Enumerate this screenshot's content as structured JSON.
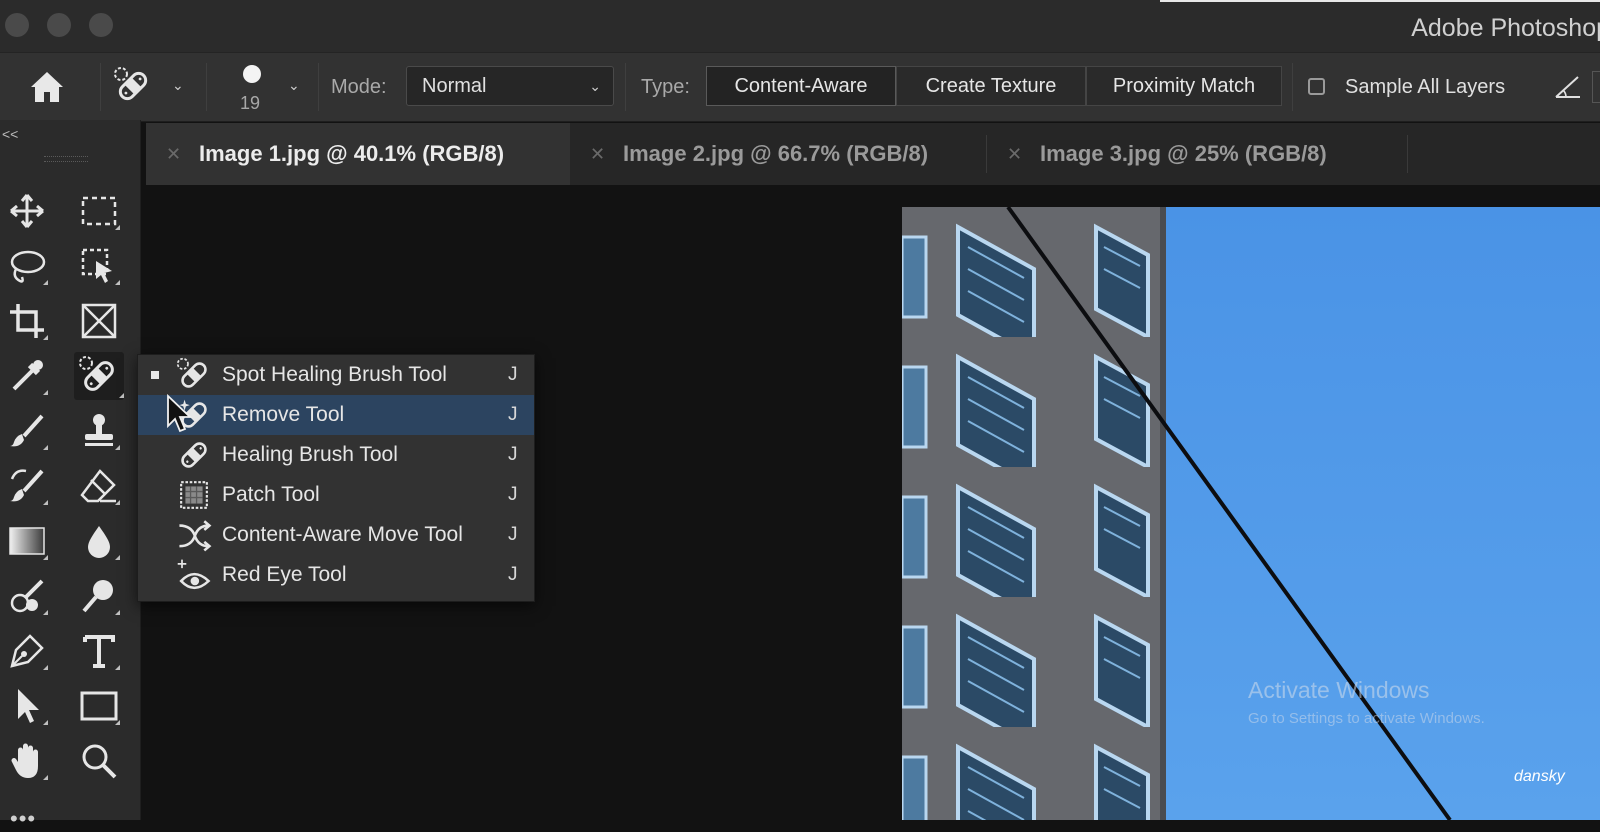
{
  "window": {
    "title": "Adobe Photoshop"
  },
  "options_bar": {
    "brush_size": "19",
    "mode_label": "Mode:",
    "mode_value": "Normal",
    "type_label": "Type:",
    "type_options": [
      "Content-Aware",
      "Create Texture",
      "Proximity Match"
    ],
    "active_type": "Content-Aware",
    "sample_all_layers_label": "Sample All Layers",
    "sample_all_layers_checked": false
  },
  "tabs": [
    {
      "label": "Image 1.jpg @ 40.1% (RGB/8)",
      "active": true
    },
    {
      "label": "Image 2.jpg @ 66.7% (RGB/8)",
      "active": false
    },
    {
      "label": "Image 3.jpg @ 25% (RGB/8)",
      "active": false
    }
  ],
  "toolbox": {
    "collapse_label": "<<",
    "more_label": "•••",
    "tools": [
      "move-icon",
      "marquee-icon",
      "lasso-icon",
      "object-select-icon",
      "crop-icon",
      "frame-icon",
      "eyedropper-icon",
      "spot-healing-brush-icon",
      "brush-icon",
      "clone-stamp-icon",
      "history-brush-icon",
      "eraser-icon",
      "gradient-icon",
      "blur-icon",
      "smudge-icon",
      "dodge-icon",
      "pen-icon",
      "type-icon",
      "path-select-icon",
      "rectangle-icon",
      "hand-icon",
      "zoom-icon"
    ],
    "selected_tool": "spot-healing-brush-icon"
  },
  "flyout": {
    "items": [
      {
        "label": "Spot Healing Brush Tool",
        "shortcut": "J",
        "current": true,
        "highlighted": false,
        "icon": "spot-healing-brush-icon"
      },
      {
        "label": "Remove Tool",
        "shortcut": "J",
        "current": false,
        "highlighted": true,
        "icon": "remove-tool-icon"
      },
      {
        "label": "Healing Brush Tool",
        "shortcut": "J",
        "current": false,
        "highlighted": false,
        "icon": "healing-brush-icon"
      },
      {
        "label": "Patch Tool",
        "shortcut": "J",
        "current": false,
        "highlighted": false,
        "icon": "patch-icon"
      },
      {
        "label": "Content-Aware Move Tool",
        "shortcut": "J",
        "current": false,
        "highlighted": false,
        "icon": "content-aware-move-icon"
      },
      {
        "label": "Red Eye Tool",
        "shortcut": "J",
        "current": false,
        "highlighted": false,
        "icon": "red-eye-icon"
      }
    ]
  },
  "overlays": {
    "activate_title": "Activate Windows",
    "activate_sub": "Go to Settings to activate Windows.",
    "signature": "dansky"
  },
  "colors": {
    "highlight": "#2c4460",
    "sky": "#4f98ea",
    "building": "#6b6d72"
  }
}
